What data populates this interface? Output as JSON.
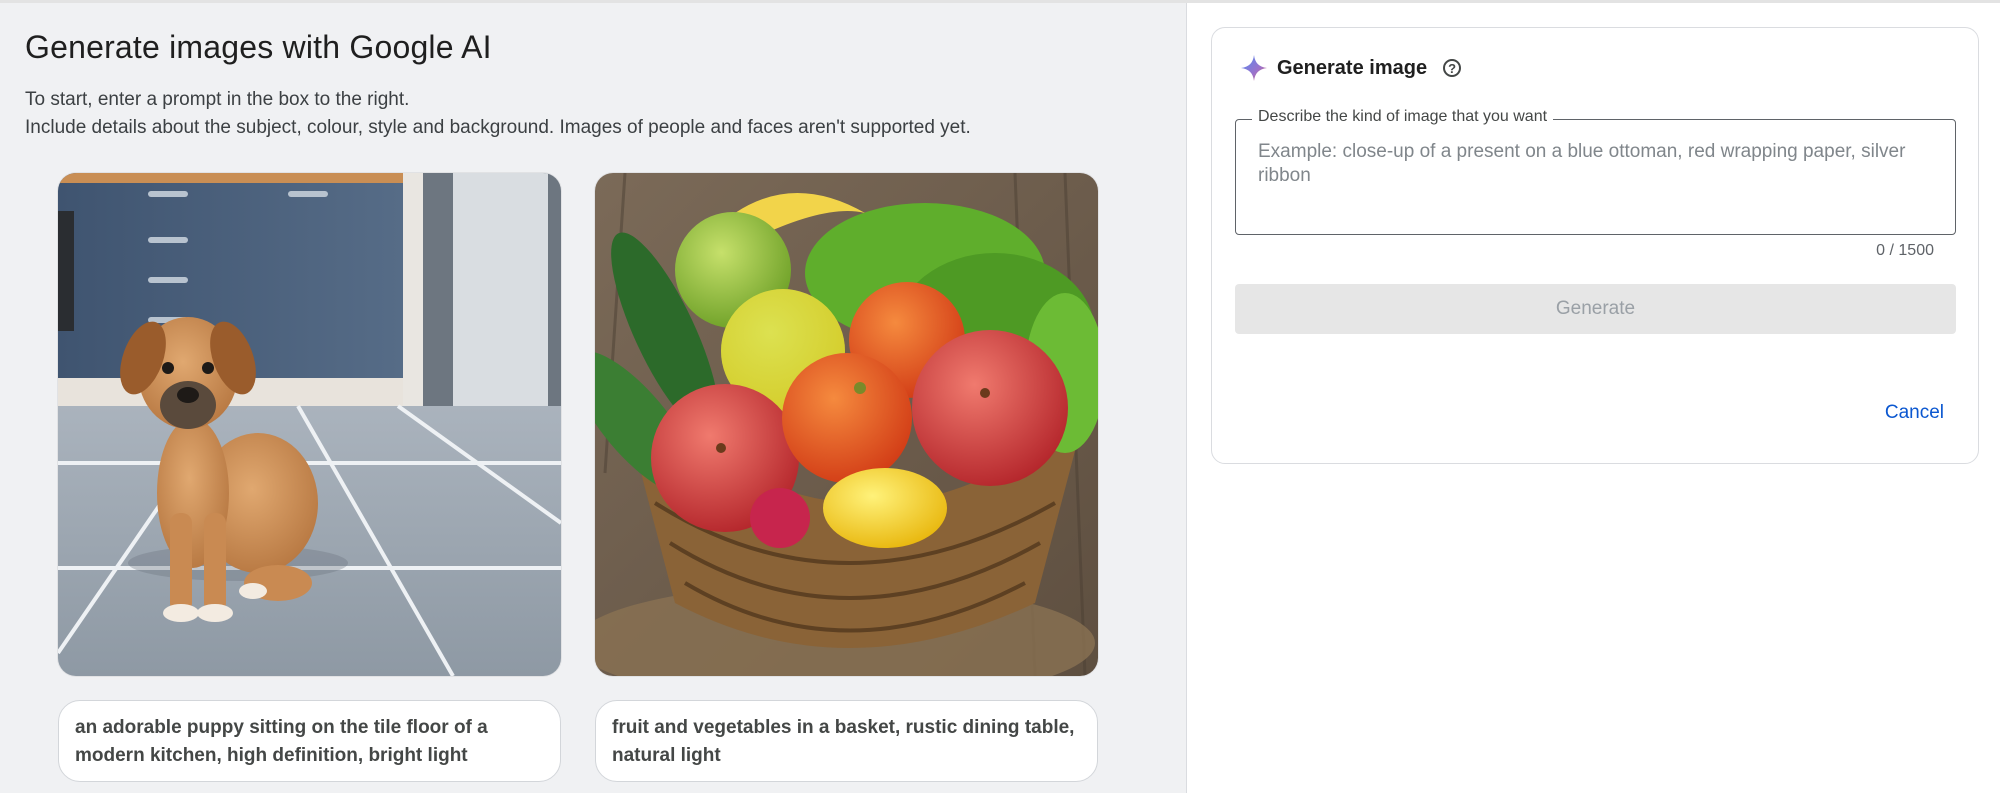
{
  "page": {
    "title": "Generate images with Google AI",
    "intro_line1": "To start, enter a prompt in the box to the right.",
    "intro_line2": "Include details about the subject, colour, style and background. Images of people and faces aren't supported yet."
  },
  "examples": [
    {
      "caption": "an adorable puppy sitting on the tile floor of a modern kitchen, high definition, bright light",
      "image": "puppy-photo"
    },
    {
      "caption": "fruit and vegetables in a basket, rustic dining table, natural light",
      "image": "fruit-basket-photo"
    }
  ],
  "panel": {
    "title": "Generate image",
    "title_icon": "sparkle-icon",
    "help_icon": "help-circle-icon",
    "help_glyph": "?",
    "field_label": "Describe the kind of image that you want",
    "field_value": "",
    "field_placeholder": "Example: close-up of a present on a blue ottoman, red wrapping paper, silver ribbon",
    "counter": "0 / 1500",
    "generate_label": "Generate",
    "cancel_label": "Cancel"
  },
  "colors": {
    "accent": "#0b57d0",
    "left_background": "#f0f1f3",
    "disabled_button": "#e6e6e6"
  }
}
